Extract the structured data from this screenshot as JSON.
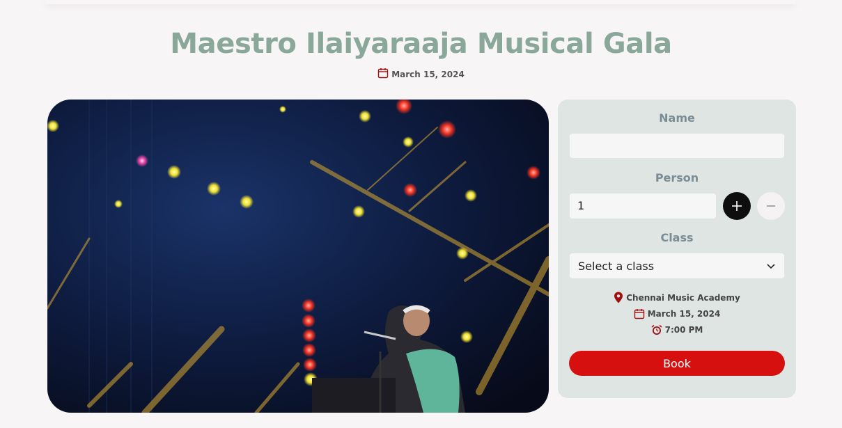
{
  "event": {
    "title": "Maestro Ilaiyaraaja Musical Gala",
    "date": "March 15, 2024"
  },
  "form": {
    "name_label": "Name",
    "name_value": "",
    "person_label": "Person",
    "person_value": "1",
    "class_label": "Class",
    "class_selected": "Select a class",
    "venue": "Chennai Music Academy",
    "date": "March 15, 2024",
    "time": "7:00 PM",
    "book_label": "Book"
  },
  "colors": {
    "title": "#8aa89a",
    "accent_red": "#d5100f",
    "panel_bg": "#dfe5e3",
    "icon_red": "#a00f0f"
  },
  "icons": {
    "date": "calendar-icon",
    "venue": "map-pin-icon",
    "time": "alarm-clock-icon",
    "select": "chevron-down-icon",
    "increment": "plus-icon",
    "decrement": "minus-icon"
  }
}
